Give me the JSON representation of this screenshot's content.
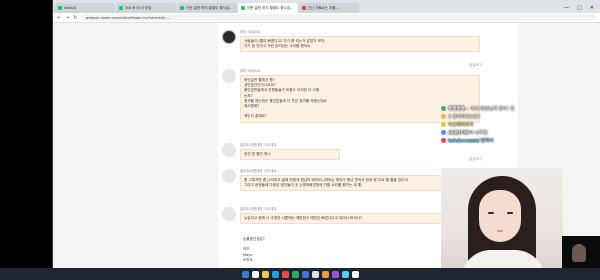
{
  "browser": {
    "tabs": [
      {
        "label": "tabb24",
        "active": false
      },
      {
        "label": "Tab 와 내 코 보임",
        "active": false
      },
      {
        "label": "이런 말한 하지 할때도 좋으십...",
        "active": false
      },
      {
        "label": "이런 말한 하지 할때도 좋으십...",
        "active": true
      },
      {
        "label": "[단] 기빠르는 저를...",
        "active": false
      }
    ],
    "url": "webpub.naver.com/ArticleRead.nhn?articleid=...",
    "window_controls": [
      "—",
      "□",
      "✕"
    ]
  },
  "comments": [
    {
      "nick": "쭈리 비싸요요",
      "text": "사람들이 (짤이 빠졌다고) 자기 좀 되는가 같았거 보자.\n자기 말 안다고 자란 흐려쉬는 소리를 했어요.",
      "time": "2023.05.14"
    },
    {
      "nick": "쭈리 비싸요요",
      "text": "용인분만 할래서 왔?\n생인분간인가니요요?\n용인분만들께서 안원들들가 비용도 이지란 더 이래\n눈치?\n청귀를 매는데는 용인분들게 더 웃은 정귀를 하겠는데요\n애서원애?\n\n메인이 끝왜요?",
      "time": "2023.05.14"
    },
    {
      "nick": "말리트러벤대표 아이대요",
      "text": "옹선 한 월인 현니",
      "time": "2023.05.14"
    },
    {
      "nick": "말리트러벤대표 아이대요",
      "text": "좀 그렇지만 좀 나라되고 골에 처음세 원심의 배리트니까리는 명리가 됐너 웃어서 현상 형 요요 할 줄울 있도어.\n그리고 현정들에 다위온 엔지들이 곳 수명적화업등메 자원 소리를 했다는 게 좋.",
      "time": "2023.05.14"
    },
    {
      "nick": "말리트러벤대표 아이대요",
      "text": "뉴임이고 음헤 너 주워전 나쁜에는 예방한고 예빈은 빠았니다고 되어나 마켜나?",
      "time": "2023.05.14"
    },
    {
      "nick": "",
      "text": "승룡중선생은?\n\n의도\nMaye\n도란도",
      "time": ""
    }
  ],
  "reply_label": "답글쓰기",
  "reply_footer": "↗ 오른쪽 답글 보기",
  "chat": [
    {
      "dot_color": "#3bb273",
      "name": "흑흑흑흑~",
      "msg": " 어서 현장님께 말이! 중",
      "color": "#ffffff"
    },
    {
      "dot_color": "#f2b84b",
      "name": "",
      "msg": "3 번지까지보요?",
      "color": "#ffffff"
    },
    {
      "dot_color": "#e8c33f",
      "name": "",
      "msg": "이선재터야가",
      "color": "#f6d86b"
    },
    {
      "dot_color": "#4a8fe0",
      "name": "[도판]미",
      "msg": "좋아 너무줍",
      "color": "#ffffff"
    },
    {
      "dot_color": "#e84a4a",
      "name": "telebocom",
      "msg": "님 영역미",
      "color": "#6bd4ff"
    }
  ],
  "taskbar_icons": [
    "#3a7bd5",
    "#ffffff",
    "#f2c94c",
    "#2d9cdb",
    "#e84a4a",
    "#27ae60",
    "#4a6fe0",
    "#e0e0e0",
    "#f2994a",
    "#9b51e0",
    "#56ccf2",
    "#ffffff"
  ]
}
